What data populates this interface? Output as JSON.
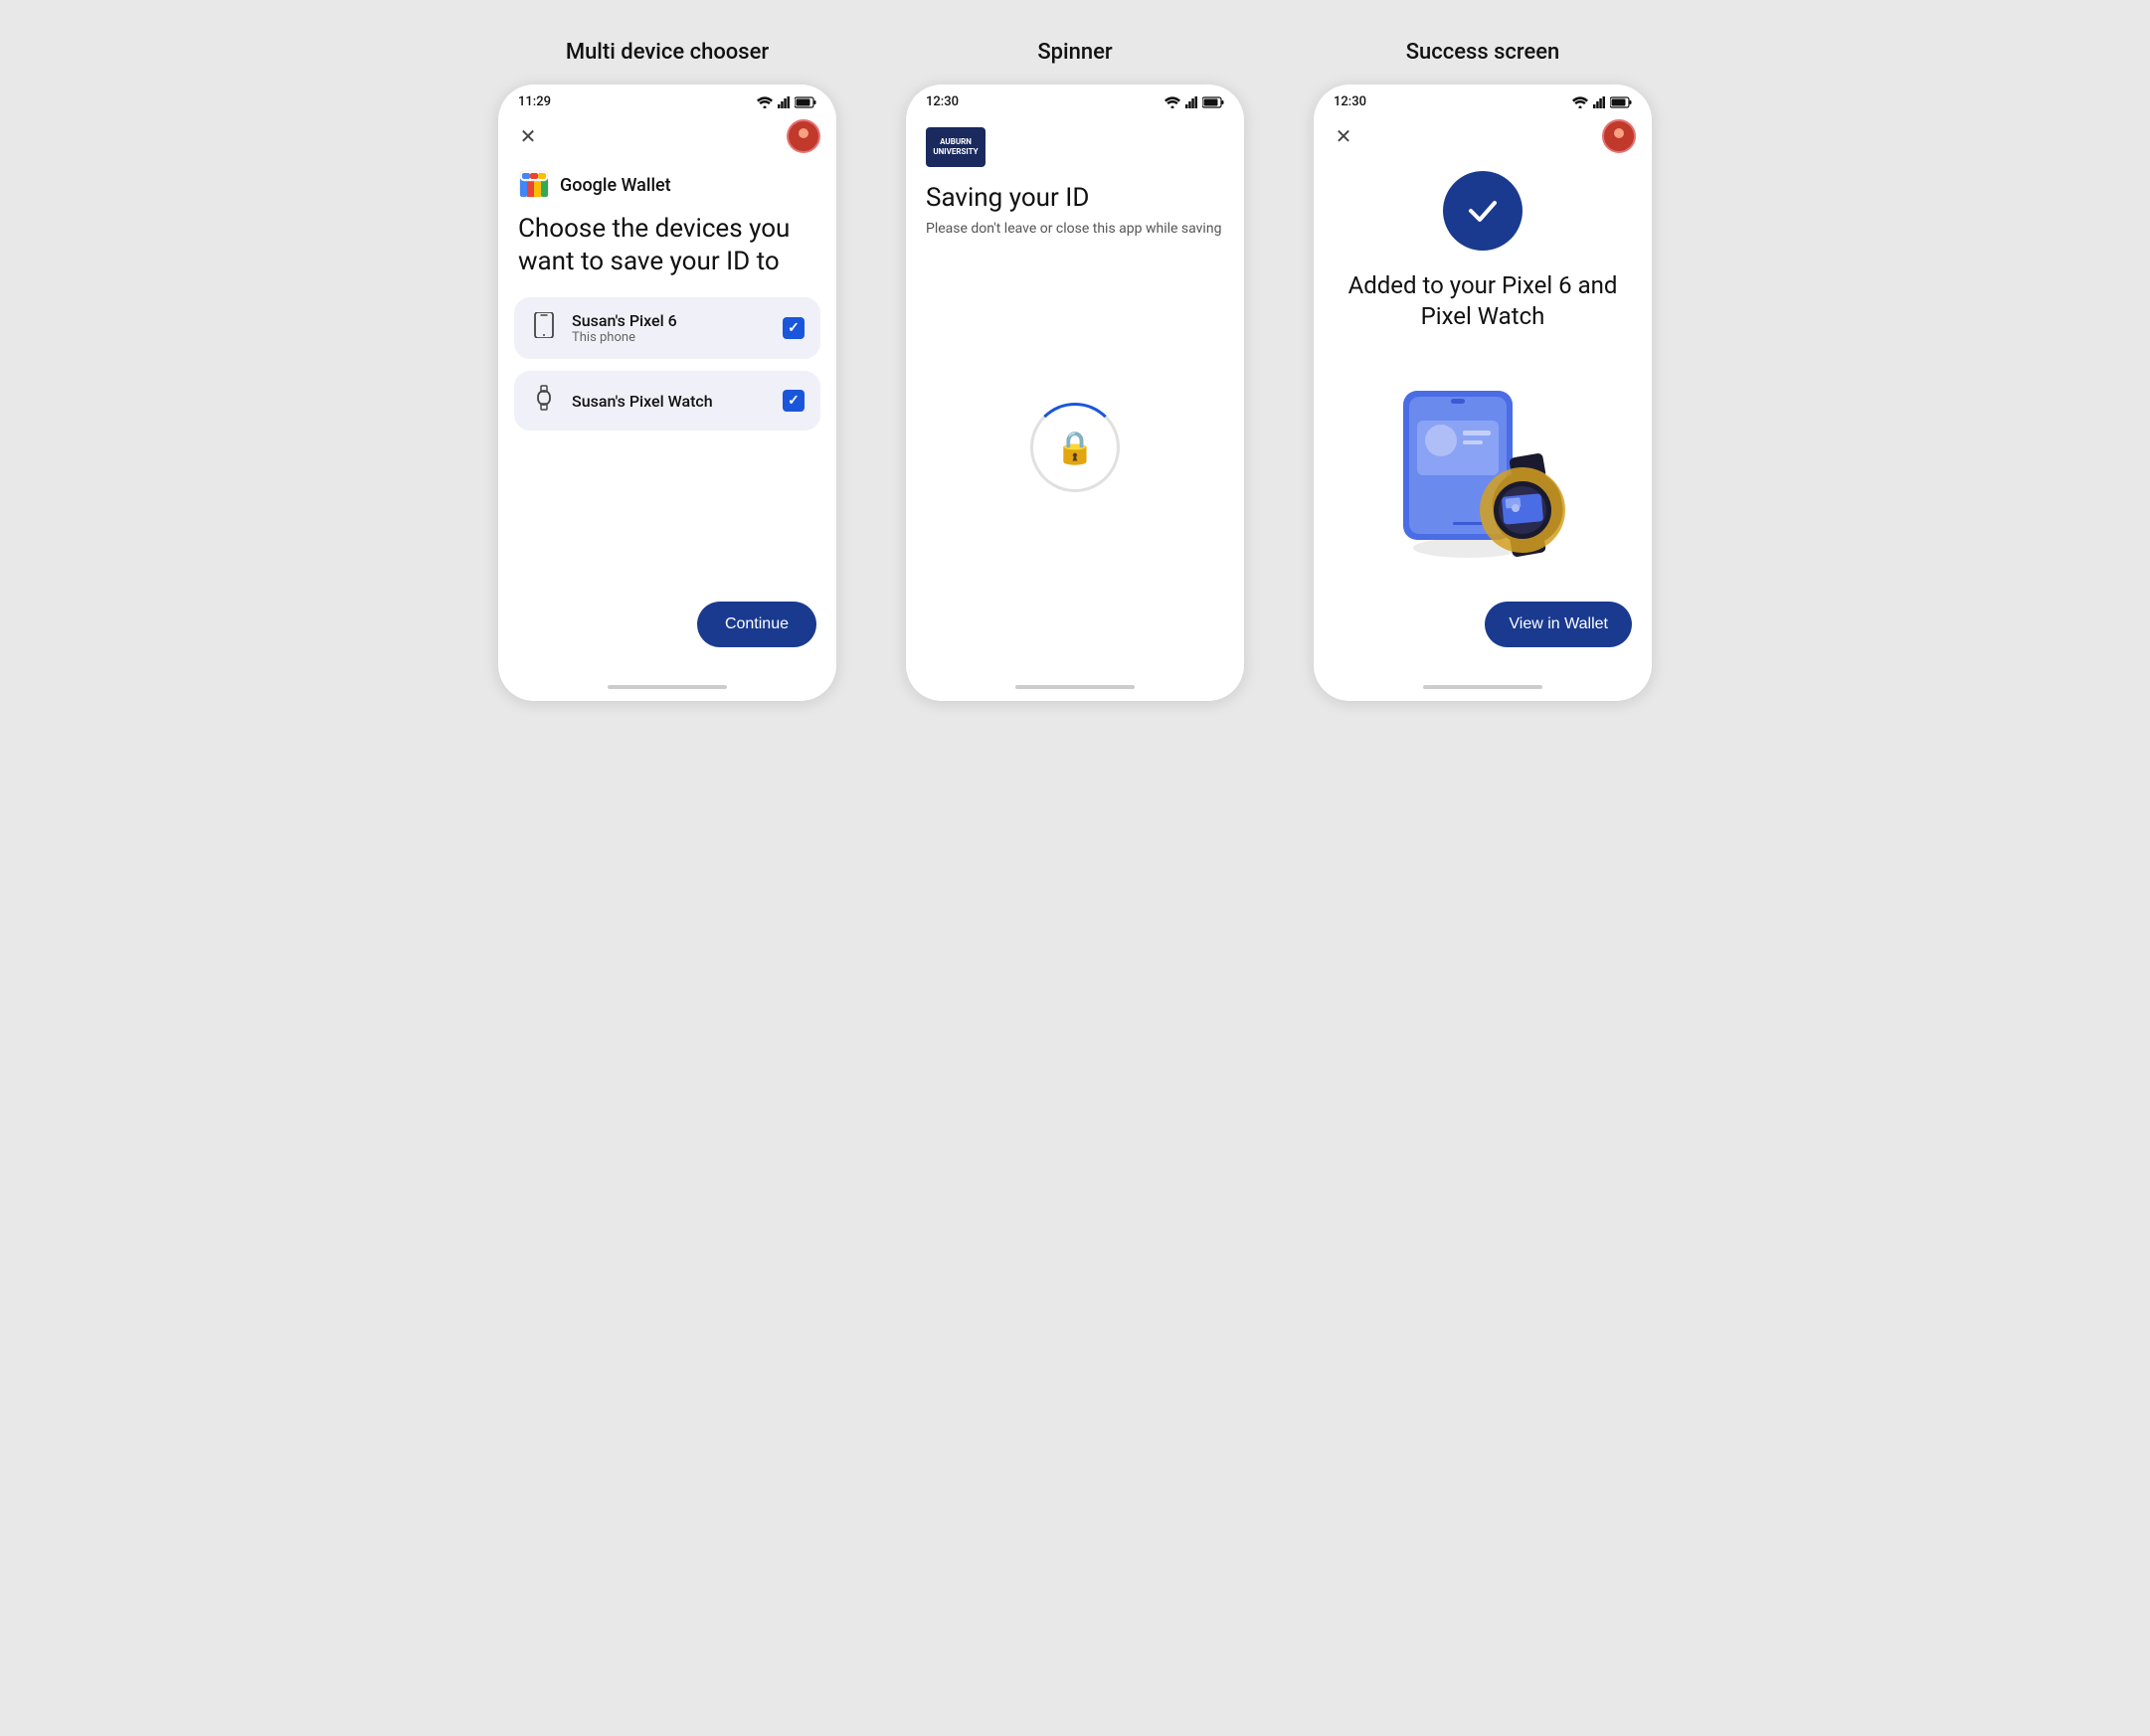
{
  "screens": [
    {
      "label": "Multi device chooser",
      "time": "11:29",
      "wallet_title": "Google Wallet",
      "heading": "Choose the devices you want to save your ID to",
      "devices": [
        {
          "name": "Susan's Pixel 6",
          "sub": "This phone",
          "icon": "phone",
          "checked": true
        },
        {
          "name": "Susan's Pixel Watch",
          "sub": "",
          "icon": "watch",
          "checked": true
        }
      ],
      "continue_label": "Continue"
    },
    {
      "label": "Spinner",
      "time": "12:30",
      "heading": "Saving your ID",
      "sub": "Please don't leave or close this app while saving"
    },
    {
      "label": "Success screen",
      "time": "12:30",
      "heading": "Added to your Pixel 6 and Pixel Watch",
      "view_label": "View in Wallet"
    }
  ]
}
